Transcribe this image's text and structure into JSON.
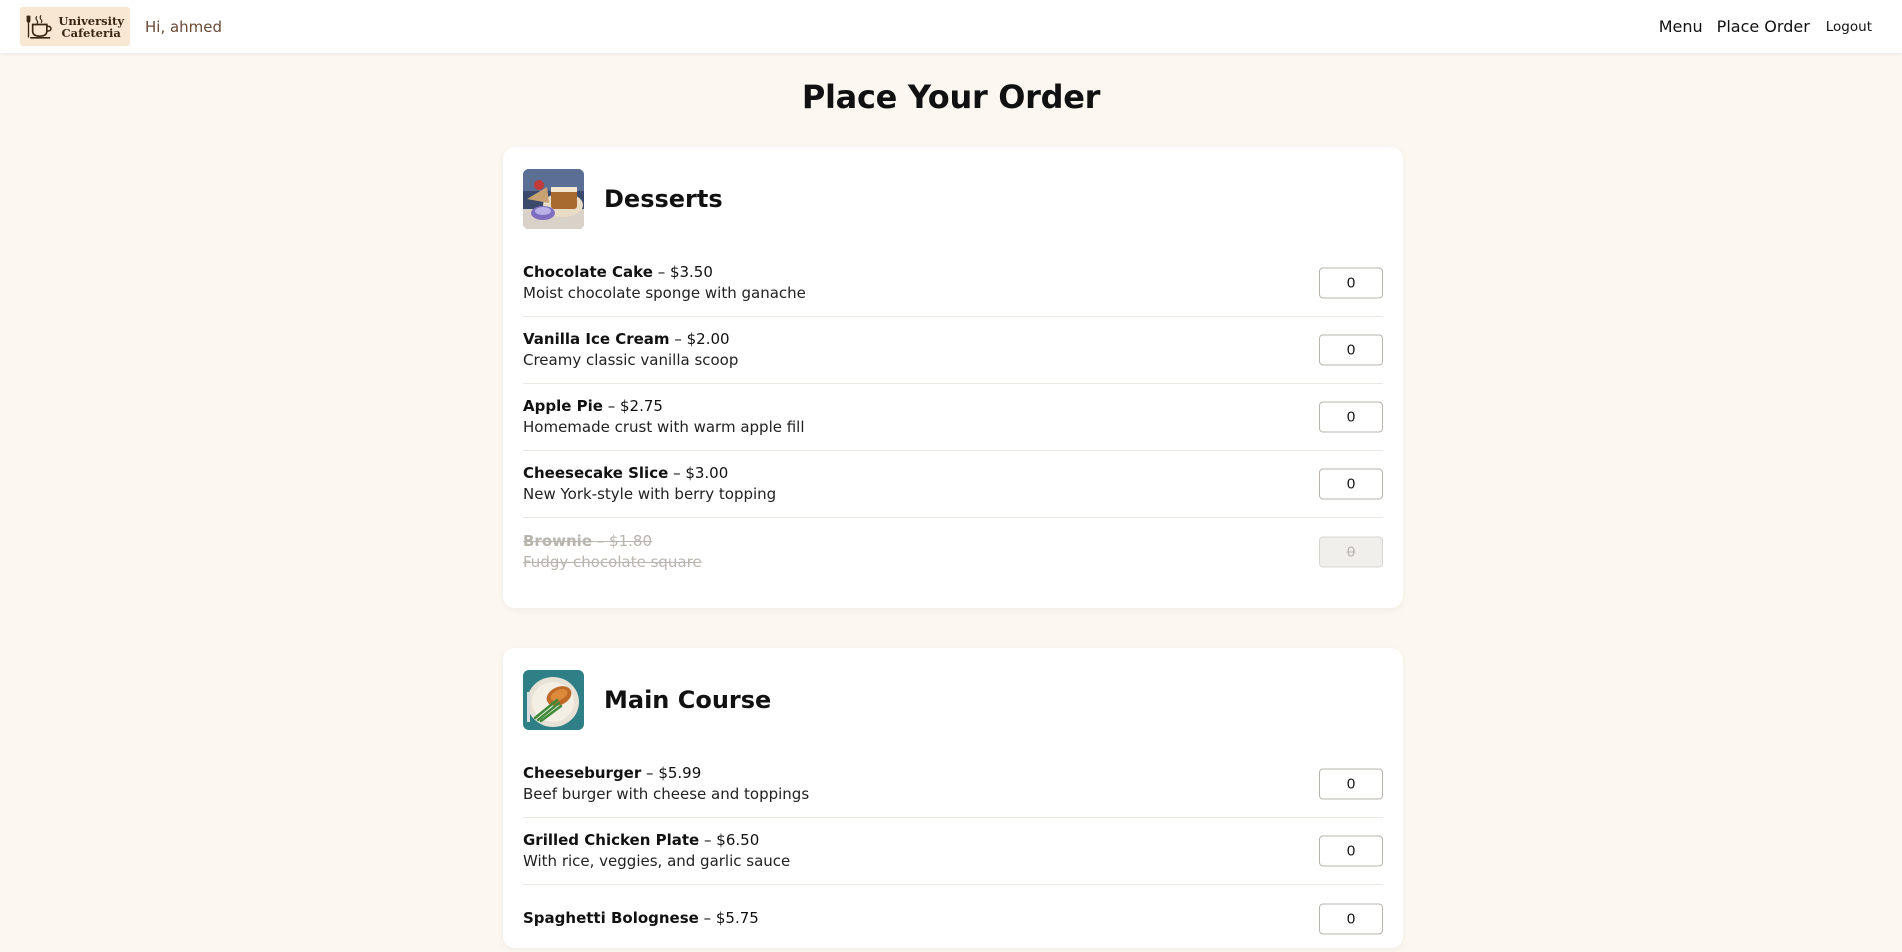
{
  "header": {
    "logo_line1": "University",
    "logo_line2": "Cafeteria",
    "greeting": "Hi, ahmed",
    "nav": {
      "menu": "Menu",
      "place_order": "Place Order",
      "logout": "Logout"
    }
  },
  "page_title": "Place Your Order",
  "categories": [
    {
      "title": "Desserts",
      "items": [
        {
          "name": "Chocolate Cake",
          "price": "– $3.50",
          "desc": "Moist chocolate sponge with ganache",
          "qty": "0"
        },
        {
          "name": "Vanilla Ice Cream",
          "price": "– $2.00",
          "desc": "Creamy classic vanilla scoop",
          "qty": "0"
        },
        {
          "name": "Apple Pie",
          "price": "– $2.75",
          "desc": "Homemade crust with warm apple fill",
          "qty": "0"
        },
        {
          "name": "Cheesecake Slice",
          "price": "– $3.00",
          "desc": "New York-style with berry topping",
          "qty": "0"
        },
        {
          "name": "Brownie",
          "price": "– $1.80",
          "desc": "Fudgy chocolate square",
          "qty": "0"
        }
      ]
    },
    {
      "title": "Main Course",
      "items": [
        {
          "name": "Cheeseburger",
          "price": "– $5.99",
          "desc": "Beef burger with cheese and toppings",
          "qty": "0"
        },
        {
          "name": "Grilled Chicken Plate",
          "price": "– $6.50",
          "desc": "With rice, veggies, and garlic sauce",
          "qty": "0"
        },
        {
          "name": "Spaghetti Bolognese",
          "price": "– $5.75",
          "desc": "",
          "qty": "0"
        }
      ]
    }
  ]
}
